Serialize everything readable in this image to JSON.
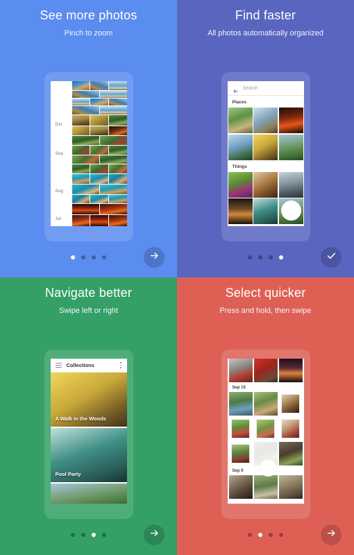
{
  "colors": {
    "panel1_bg": "#5b8cef",
    "panel2_bg": "#5a65bf",
    "panel3_bg": "#34a065",
    "panel4_bg": "#de6055",
    "dot_active": "#ffffff",
    "dot_inactive": "rgba(0,0,0,0.32)"
  },
  "panels": [
    {
      "id": "see-more-photos",
      "title": "See more photos",
      "subtitle": "Pinch to zoom",
      "dots": {
        "count": 4,
        "active_index": 0
      },
      "fab": {
        "icon": "arrow-right-icon",
        "label": "Next"
      },
      "timeline": {
        "months": [
          "Oct",
          "Sep",
          "Aug",
          "Jul"
        ]
      }
    },
    {
      "id": "find-faster",
      "title": "Find faster",
      "subtitle": "All photos automatically organized",
      "dots": {
        "count": 4,
        "active_index": 3
      },
      "fab": {
        "icon": "check-icon",
        "label": "Done"
      },
      "search": {
        "back_icon": "arrow-left-icon",
        "placeholder": "Search",
        "value": ""
      },
      "sections": [
        {
          "heading": "Places",
          "photo_count": 6
        },
        {
          "heading": "Things",
          "photo_count": 6
        }
      ],
      "touch_indicator": true
    },
    {
      "id": "navigate-better",
      "title": "Navigate better",
      "subtitle": "Swipe left or right",
      "dots": {
        "count": 4,
        "active_index": 2
      },
      "fab": {
        "icon": "arrow-right-icon",
        "label": "Next"
      },
      "appbar": {
        "menu_icon": "hamburger-icon",
        "title": "Collections",
        "overflow_icon": "kebab-menu-icon"
      },
      "cards": [
        {
          "label": "A Walk in the Woods"
        },
        {
          "label": "Pool Party"
        },
        {
          "label": ""
        }
      ]
    },
    {
      "id": "select-quicker",
      "title": "Select quicker",
      "subtitle": "Press and hold, then swipe",
      "dots": {
        "count": 4,
        "active_index": 1
      },
      "fab": {
        "icon": "arrow-right-icon",
        "label": "Next"
      },
      "date_headers": [
        "Sep 15",
        "Sep 9"
      ],
      "touch_indicator": true
    }
  ]
}
